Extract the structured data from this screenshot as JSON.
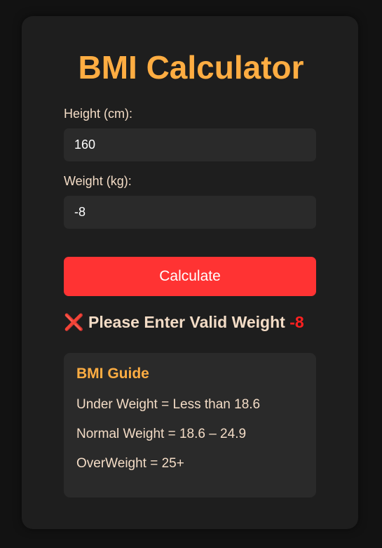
{
  "app": {
    "title": "BMI Calculator"
  },
  "form": {
    "height_label": "Height (cm):",
    "height_value": "160",
    "weight_label": "Weight (kg):",
    "weight_value": "-8",
    "submit_label": "Calculate"
  },
  "result": {
    "icon": "❌",
    "message": "Please Enter Valid Weight",
    "value": "-8"
  },
  "guide": {
    "title": "BMI Guide",
    "items": [
      "Under Weight = Less than 18.6",
      "Normal Weight = 18.6 – 24.9",
      "OverWeight = 25+"
    ]
  },
  "colors": {
    "page_background": "#121212",
    "card_background": "#1e1e1e",
    "accent": "#ffad42",
    "button": "#ff3333",
    "error_value": "#ff2020",
    "text": "#f3dcc6"
  }
}
